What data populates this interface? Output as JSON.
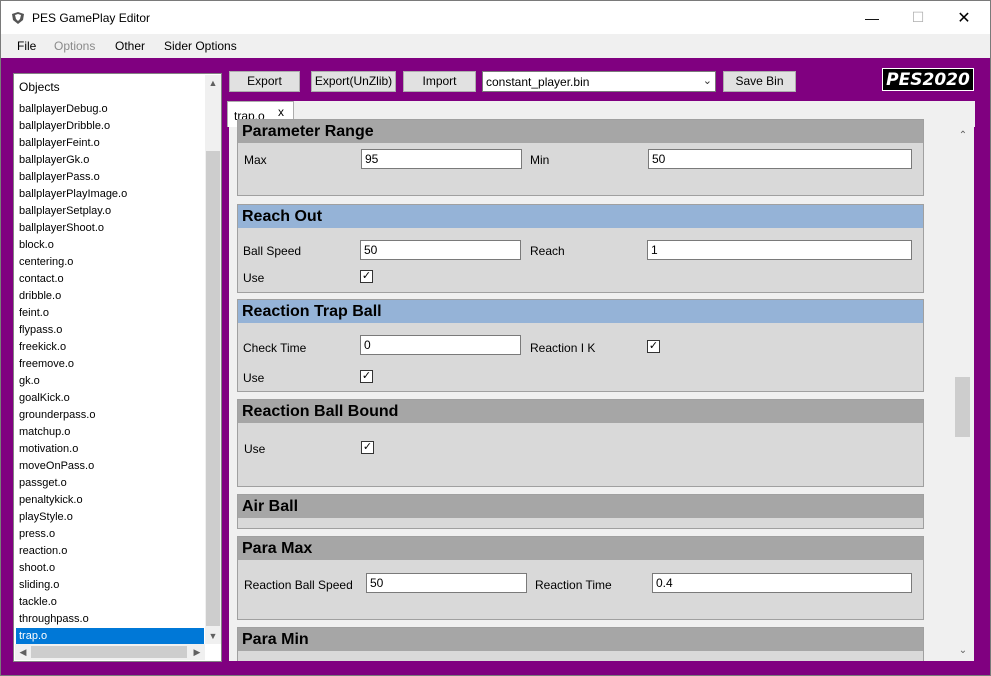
{
  "window": {
    "title": "PES GamePlay Editor"
  },
  "menu": [
    "File",
    "Options",
    "Other",
    "Sider Options"
  ],
  "objects": {
    "header": "Objects",
    "items": [
      "ballplayerDebug.o",
      "ballplayerDribble.o",
      "ballplayerFeint.o",
      "ballplayerGk.o",
      "ballplayerPass.o",
      "ballplayerPlayImage.o",
      "ballplayerSetplay.o",
      "ballplayerShoot.o",
      "block.o",
      "centering.o",
      "contact.o",
      "dribble.o",
      "feint.o",
      "flypass.o",
      "freekick.o",
      "freemove.o",
      "gk.o",
      "goalKick.o",
      "grounderpass.o",
      "matchup.o",
      "motivation.o",
      "moveOnPass.o",
      "passget.o",
      "penaltykick.o",
      "playStyle.o",
      "press.o",
      "reaction.o",
      "shoot.o",
      "sliding.o",
      "tackle.o",
      "throughpass.o",
      "trap.o"
    ],
    "selected": "trap.o"
  },
  "toolbar": {
    "export": "Export",
    "export_unzlib": "Export(UnZlib)",
    "import": "Import",
    "file": "constant_player.bin",
    "save_bin": "Save Bin"
  },
  "logo": "PES2020",
  "tab": {
    "label": "trap.o",
    "close": "x"
  },
  "groups": {
    "param_range": {
      "title": "Parameter Range",
      "max_label": "Max",
      "max": "95",
      "min_label": "Min",
      "min": "50"
    },
    "reach_out": {
      "title": "Reach Out",
      "ball_speed_label": "Ball Speed",
      "ball_speed": "50",
      "reach_label": "Reach",
      "reach": "1",
      "use_label": "Use",
      "use": true
    },
    "reaction_trap": {
      "title": "Reaction Trap Ball",
      "check_time_label": "Check Time",
      "check_time": "0",
      "reaction_ik_label": "Reaction I K",
      "reaction_ik": true,
      "use_label": "Use",
      "use": true
    },
    "reaction_bound": {
      "title": "Reaction Ball Bound",
      "use_label": "Use",
      "use": true
    },
    "air_ball": {
      "title": "Air Ball"
    },
    "para_max": {
      "title": "Para Max",
      "rbs_label": "Reaction Ball Speed",
      "rbs": "50",
      "rt_label": "Reaction Time",
      "rt": "0.4"
    },
    "para_min": {
      "title": "Para Min"
    }
  }
}
